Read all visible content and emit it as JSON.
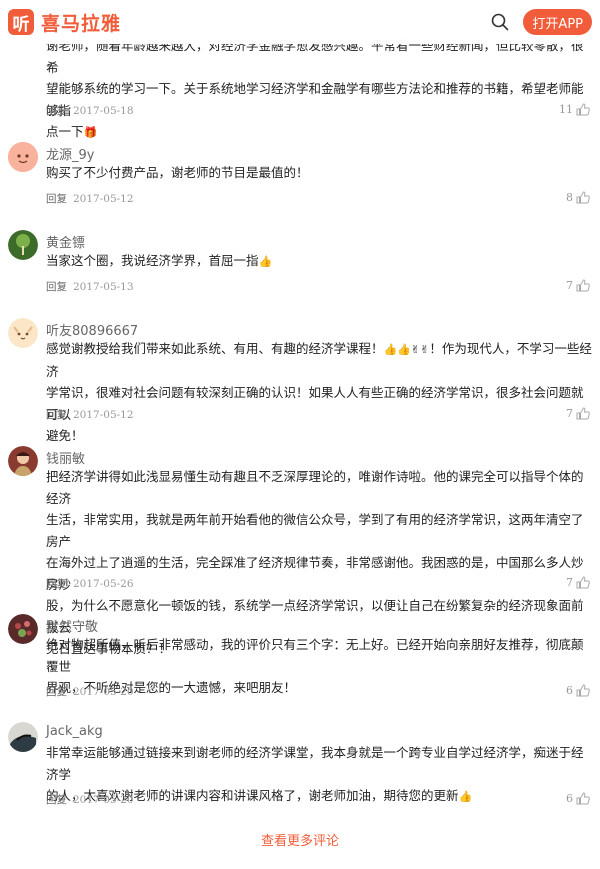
{
  "header": {
    "logo_glyph": "听",
    "logo_text": "喜马拉雅",
    "open_app_label": "打开APP",
    "brand_color": "#f15d3a"
  },
  "comments": [
    {
      "user": "",
      "text_lines": [
        "谢老师，随着年龄越来越大，对经济学金融学愈发感兴趣。平常看一些财经新闻，但比较零散，很希",
        "望能够系统的学习一下。关于系统地学习经济学和金融学有哪些方法论和推荐的书籍，希望老师能够指",
        "点一下"
      ],
      "reply_label": "回复",
      "date": "2017-05-18",
      "likes": "11"
    },
    {
      "user": "龙源_9y",
      "text_lines": [
        "购买了不少付费产品，谢老师的节目是最值的！"
      ],
      "reply_label": "回复",
      "date": "2017-05-12",
      "likes": "8"
    },
    {
      "user": "黄金镖",
      "text_lines": [
        "当家这个圈，我说经济学界，首屈一指"
      ],
      "reply_label": "回复",
      "date": "2017-05-13",
      "likes": "7"
    },
    {
      "user": "听友80896667",
      "text_lines": [
        "感觉谢教授给我们带来如此系统、有用、有趣的经济学课程！",
        "！作为现代人，不学习一些经济",
        "学常识，很难对社会问题有较深刻正确的认识！如果人人有些正确的经济学常识，很多社会问题就可以",
        "避免！"
      ],
      "reply_label": "回复",
      "date": "2017-05-12",
      "likes": "7"
    },
    {
      "user": "钱丽敏",
      "text_lines": [
        "把经济学讲得如此浅显易懂生动有趣且不乏深厚理论的，唯谢作诗啦。他的课完全可以指导个体的经济",
        "生活，非常实用，我就是两年前开始看他的微信公众号，学到了有用的经济学常识，这两年清空了房产",
        "在海外过上了逍遥的生活，完全踩准了经济规律节奏，非常感谢他。我困惑的是，中国那么多人炒房炒",
        "股，为什么不愿意化一顿饭的钱，系统学一点经济学常识，以便让自己在纷繁复杂的经济现象面前拔云",
        "见日直达事物本质？！"
      ],
      "reply_label": "回复",
      "date": "2017-05-26",
      "likes": "7"
    },
    {
      "user": "默然守敬",
      "text_lines": [
        "绝对物超所值，听后非常感动，我的评价只有三个字：无上好。已经开始向亲朋好友推荐，彻底颠覆世",
        "界观，不听绝对是您的一大遗憾，来吧朋友！"
      ],
      "reply_label": "回复",
      "date": "2017-05-20",
      "likes": "6"
    },
    {
      "user": "Jack_akg",
      "text_lines": [
        "非常幸运能够通过链接来到谢老师的经济学课堂，我本身就是一个跨专业自学过经济学，痴迷于经济学",
        "的人，太喜欢谢老师的讲课内容和讲课风格了，谢老师加油，期待您的更新"
      ],
      "reply_label": "回复",
      "date": "2017-05-20",
      "likes": "6"
    }
  ],
  "more_label": "查看更多评论"
}
